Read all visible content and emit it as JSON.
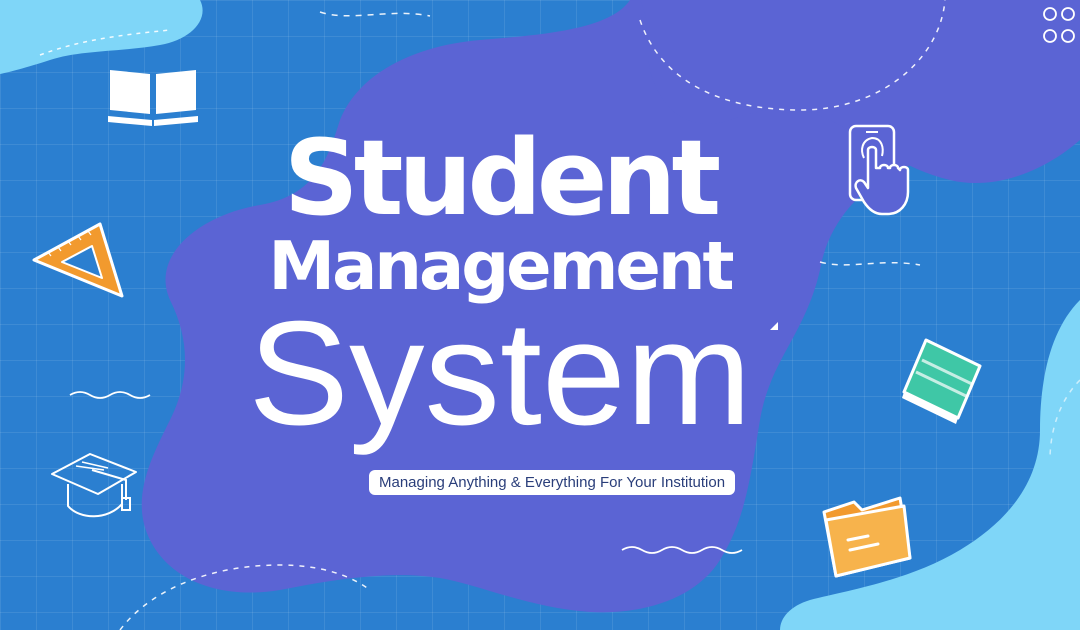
{
  "banner": {
    "title_line1": "Student",
    "title_line2": "Management",
    "title_line3": "System",
    "tagline": "Managing Anything & Everything For Your Institution"
  },
  "icons": [
    "open-book-icon",
    "ruler-triangle-icon",
    "graduation-cap-icon",
    "mobile-touch-icon",
    "green-book-icon",
    "orange-folder-icon",
    "circles-grid-icon"
  ],
  "colors": {
    "background_blue": "#2b7fd0",
    "blob_purple": "#5b64d4",
    "blob_light_blue": "#7fd6f8",
    "text_white": "#ffffff",
    "tagline_text": "#2a3e7a",
    "accent_orange": "#f29a2e",
    "accent_green": "#3fc7a6"
  }
}
